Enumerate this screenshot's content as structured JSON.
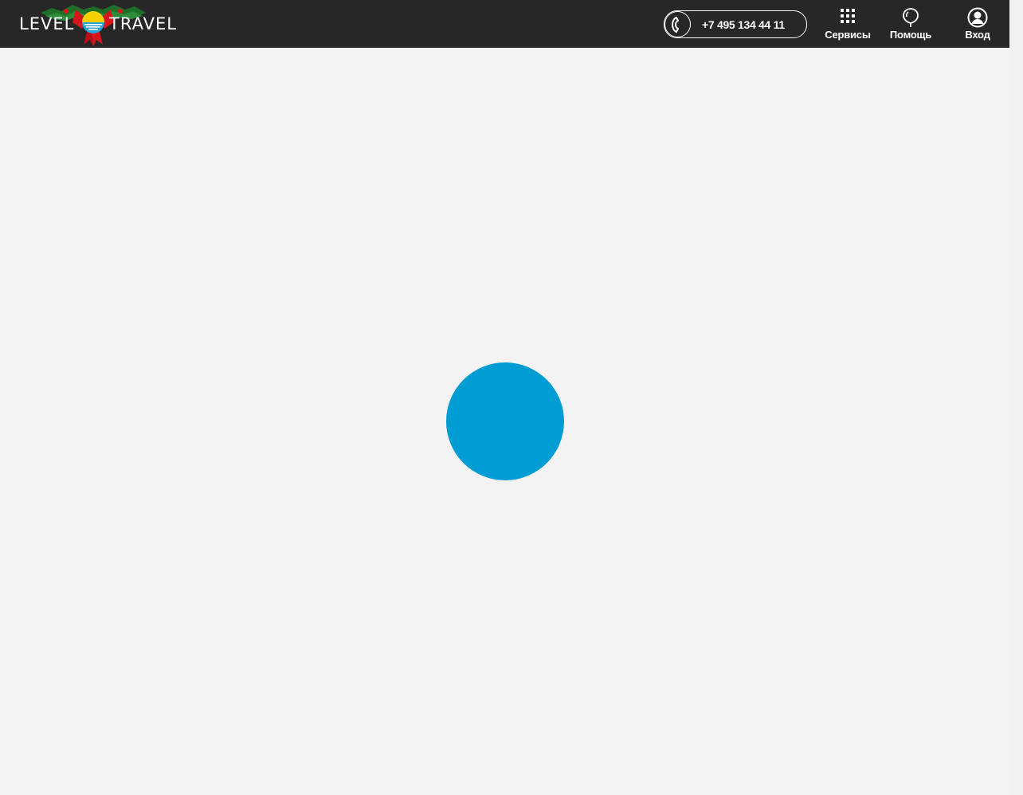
{
  "brand": {
    "name_left": "LEVEL",
    "name_right": "TRAVEL",
    "logo_sun_color": "#f7d000",
    "logo_water_color": "#29a3db",
    "logo_ribbon_color": "#d9141b",
    "logo_pine_color": "#1f6e2a"
  },
  "header": {
    "background_color": "#272727",
    "phone": {
      "icon": "phone-icon",
      "number": "+7 495 134 44 11"
    },
    "nav": [
      {
        "label": "Сервисы",
        "icon": "grid-icon"
      },
      {
        "label": "Помощь",
        "icon": "balloon-icon"
      },
      {
        "label": "Вход",
        "icon": "user-icon"
      }
    ]
  },
  "main": {
    "background_color": "#f3f3f3",
    "loader": {
      "color": "#009cd4",
      "icon": "loading-spinner-icon"
    }
  }
}
